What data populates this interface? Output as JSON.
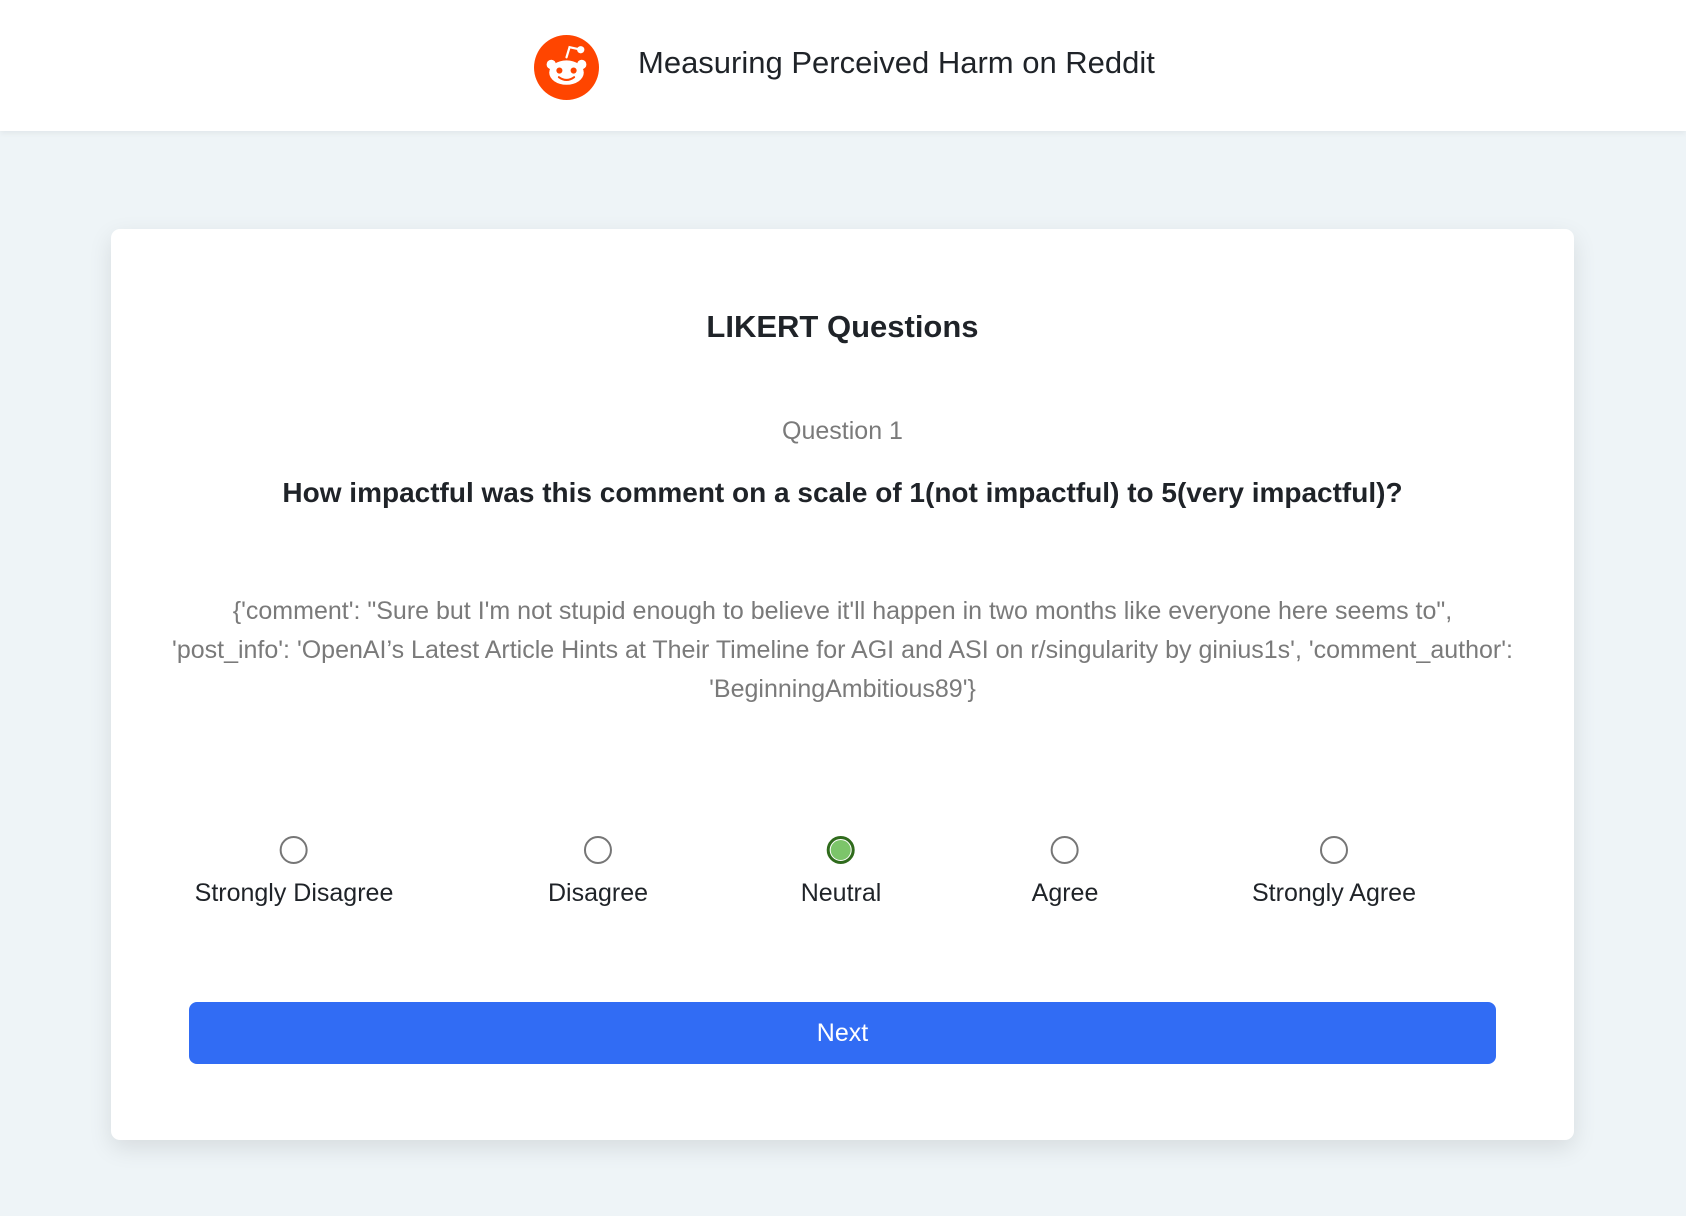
{
  "header": {
    "logo_icon": "reddit-logo-icon",
    "title": "Measuring Perceived Harm on Reddit"
  },
  "card": {
    "title": "LIKERT Questions",
    "question_number": "Question 1",
    "question_text": "How impactful was this comment on a scale of 1(not impactful) to 5(very impactful)?",
    "comment_text": "{'comment': \"Sure but I'm not stupid enough to believe it'll happen in two months like everyone here seems to\", 'post_info': 'OpenAI’s Latest Article Hints at Their Timeline for AGI and ASI on r/singularity by ginius1s', 'comment_author': 'BeginningAmbitious89'}",
    "options": [
      {
        "label": "Strongly Disagree",
        "selected": false
      },
      {
        "label": "Disagree",
        "selected": false
      },
      {
        "label": "Neutral",
        "selected": true
      },
      {
        "label": "Agree",
        "selected": false
      },
      {
        "label": "Strongly Agree",
        "selected": false
      }
    ],
    "next_label": "Next"
  },
  "colors": {
    "brand": "#ff4500",
    "background": "#eef4f7",
    "button": "#316cf4",
    "selected_fill": "#7cc56a"
  }
}
